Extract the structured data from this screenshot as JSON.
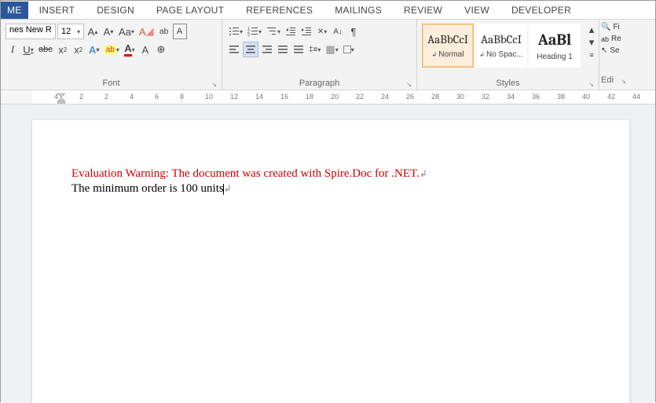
{
  "tabs": {
    "home": "ME",
    "insert": "INSERT",
    "design": "DESIGN",
    "page_layout": "PAGE LAYOUT",
    "references": "REFERENCES",
    "mailings": "MAILINGS",
    "review": "REVIEW",
    "view": "VIEW",
    "developer": "DEVELOPER"
  },
  "font": {
    "name": "nes New R",
    "size": "12",
    "group_label": "Font"
  },
  "paragraph": {
    "group_label": "Paragraph"
  },
  "styles": {
    "group_label": "Styles",
    "items": [
      {
        "preview": "AaBbCcI",
        "name": "Normal",
        "selected": true,
        "paragraph_mark": true
      },
      {
        "preview": "AaBbCcI",
        "name": "No Spac...",
        "selected": false,
        "paragraph_mark": true
      },
      {
        "preview": "AaBl",
        "name": "Heading 1",
        "selected": false,
        "big": true
      }
    ]
  },
  "editing": {
    "find": "Fi",
    "replace": "Re",
    "select": "Se",
    "group_label": "Edi"
  },
  "ruler": {
    "marks": [
      -4,
      -2,
      2,
      4,
      6,
      8,
      10,
      12,
      14,
      16,
      18,
      20,
      22,
      24,
      26,
      28,
      30,
      32,
      34,
      36,
      38,
      40,
      42,
      44
    ]
  },
  "document": {
    "warning": "Evaluation Warning: The document was created with Spire.Doc for .NET.",
    "body": "The minimum order is 100 units"
  }
}
